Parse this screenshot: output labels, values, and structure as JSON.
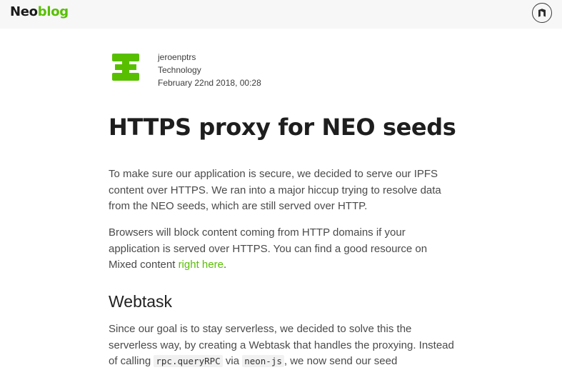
{
  "header": {
    "brand_part1": "Neo",
    "brand_part2": "blog",
    "brand_color": "#58bf00",
    "corner_icon": "neo-logo-icon"
  },
  "author": {
    "icon": "author-avatar-icon",
    "avatar_color": "#58bf00",
    "name": "jeroenptrs",
    "category": "Technology",
    "date": "February 22nd 2018, 00:28"
  },
  "article": {
    "title": "HTTPS proxy for NEO seeds",
    "para1": "To make sure our application is secure, we decided to serve our IPFS content over HTTPS. We ran into a major hiccup trying to resolve data from the NEO seeds, which are still served over HTTP.",
    "para2_text": "Browsers will block content coming from HTTP domains if your application is served over HTTPS. You can find a good resource on Mixed content ",
    "para2_link": "right here",
    "para2_end": ".",
    "heading2": "Webtask",
    "para3_a": "Since our goal is to stay serverless, we decided to solve this the serverless way, by creating a Webtask that handles the proxying. Instead of calling ",
    "para3_code1": "rpc.queryRPC",
    "para3_b": " via ",
    "para3_code2": "neon-js",
    "para3_c": ", we now send our seed"
  }
}
